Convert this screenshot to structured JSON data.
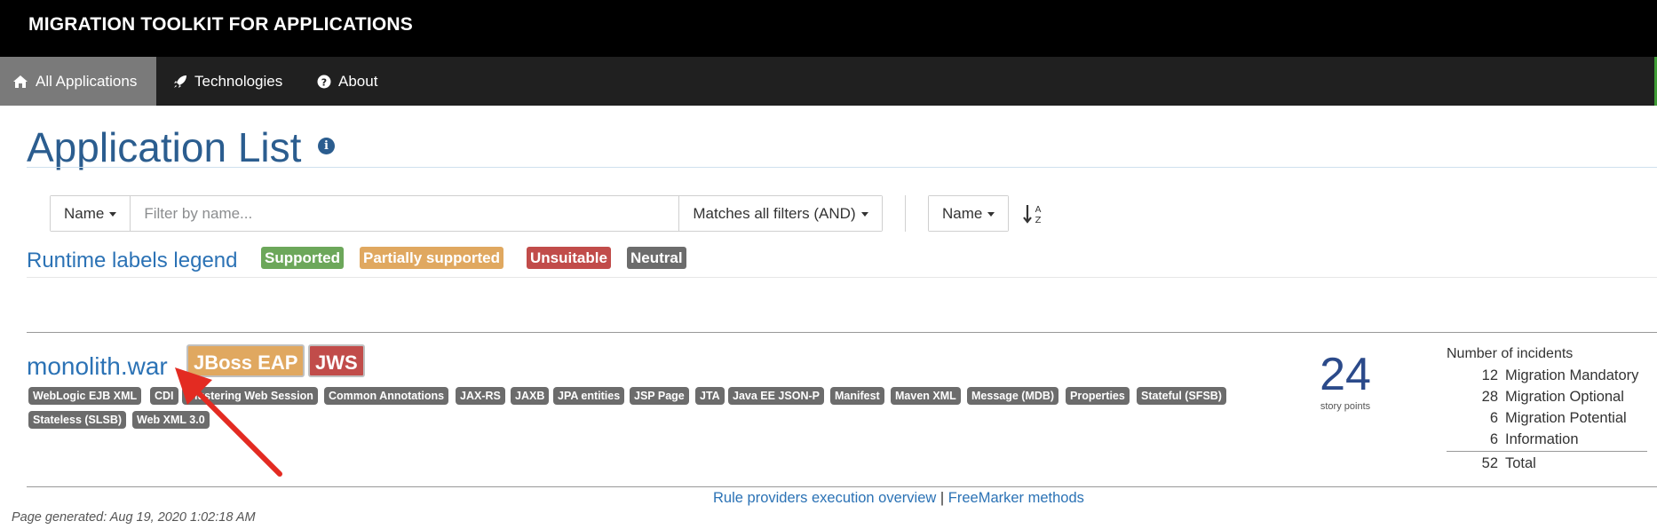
{
  "brand": "MIGRATION TOOLKIT FOR APPLICATIONS",
  "nav": {
    "items": [
      {
        "label": "All Applications",
        "icon": "home-icon",
        "active": true
      },
      {
        "label": "Technologies",
        "icon": "rocket-icon",
        "active": false
      },
      {
        "label": "About",
        "icon": "question-circle-icon",
        "active": false
      }
    ]
  },
  "page": {
    "title": "Application List",
    "title_info_icon": "info-icon"
  },
  "filter": {
    "field_label": "Name",
    "placeholder": "Filter by name...",
    "match_label": "Matches all filters (AND)",
    "sort_label": "Name",
    "sort_icon": "sort-alpha-asc-icon"
  },
  "legend": {
    "title": "Runtime labels legend",
    "items": [
      {
        "label": "Supported",
        "color": "#6ca75a"
      },
      {
        "label": "Partially supported",
        "color": "#e0a860"
      },
      {
        "label": "Unsuitable",
        "color": "#c14c4a"
      },
      {
        "label": "Neutral",
        "color": "#6c6c6c"
      }
    ]
  },
  "application": {
    "name": "monolith.war",
    "runtimes": [
      {
        "label": "JBoss EAP",
        "color": "#e0a860"
      },
      {
        "label": "JWS",
        "color": "#c14c4a"
      }
    ],
    "tags": [
      "WebLogic EJB XML",
      "CDI",
      "Clustering Web Session",
      "Common Annotations",
      "JAX-RS",
      "JAXB",
      "JPA entities",
      "JSP Page",
      "JTA",
      "Java EE JSON-P",
      "Manifest",
      "Maven XML",
      "Message (MDB)",
      "Properties",
      "Stateful (SFSB)",
      "Stateless (SLSB)",
      "Web XML 3.0"
    ],
    "story_points": "24",
    "story_points_label": "story points",
    "incidents": {
      "title": "Number of incidents",
      "rows": [
        {
          "count": "12",
          "label": "Migration Mandatory"
        },
        {
          "count": "28",
          "label": "Migration Optional"
        },
        {
          "count": "6",
          "label": "Migration Potential"
        },
        {
          "count": "6",
          "label": "Information"
        }
      ],
      "total_count": "52",
      "total_label": "Total"
    }
  },
  "footer": {
    "link1": "Rule providers execution overview",
    "separator": "|",
    "link2": "FreeMarker methods",
    "generated": "Page generated: Aug 19, 2020 1:02:18 AM"
  }
}
